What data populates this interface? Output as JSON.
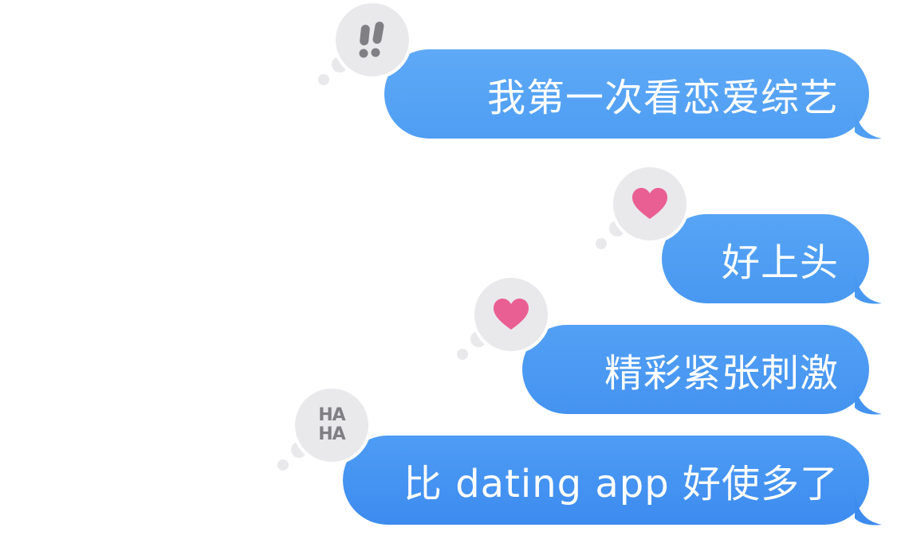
{
  "colors": {
    "bubble_top": "#5ea9f7",
    "bubble_bottom": "#3d8bef",
    "tapback_bg": "#e9e9ec",
    "heart": "#ea5f93",
    "haha": "#7f7f84",
    "exclaim": "#7f7f84"
  },
  "messages": [
    {
      "text": "我第一次看恋爱综艺",
      "tapback": "exclamation-icon"
    },
    {
      "text": "好上头",
      "tapback": "heart-icon"
    },
    {
      "text": "精彩紧张刺激",
      "tapback": "heart-icon"
    },
    {
      "text": "比 dating app 好使多了",
      "tapback": "haha-icon"
    }
  ],
  "tapbacks": {
    "haha_top": "HA",
    "haha_bottom": "HA"
  }
}
